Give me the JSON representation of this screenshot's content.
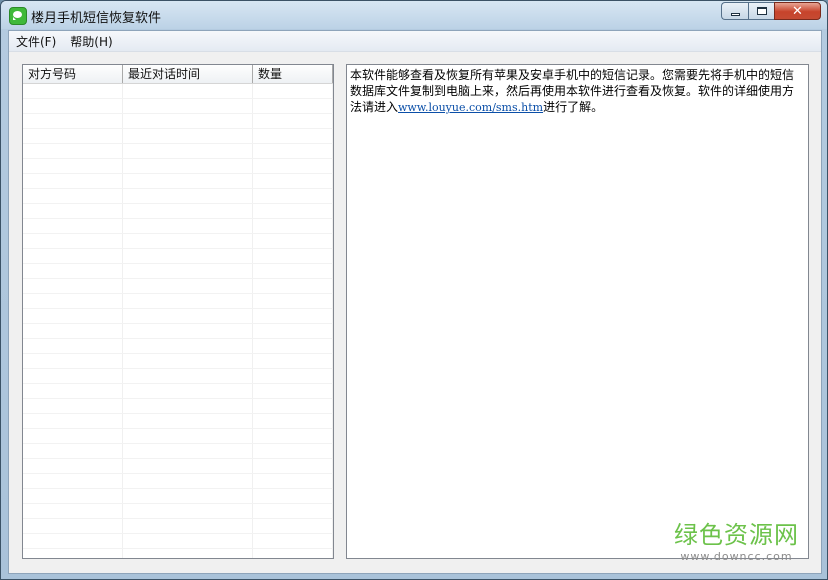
{
  "window": {
    "title": "楼月手机短信恢复软件",
    "icon": "message-bubble-icon",
    "controls": {
      "minimize": "minimize-icon",
      "maximize": "maximize-icon",
      "close": "close-icon"
    }
  },
  "menu": {
    "items": [
      {
        "label": "文件(F)"
      },
      {
        "label": "帮助(H)"
      }
    ]
  },
  "conversation_list": {
    "columns": [
      {
        "label": "对方号码"
      },
      {
        "label": "最近对话时间"
      },
      {
        "label": "数量"
      }
    ],
    "rows": []
  },
  "info_text": {
    "before_link": "本软件能够查看及恢复所有苹果及安卓手机中的短信记录。您需要先将手机中的短信数据库文件复制到电脑上来，然后再使用本软件进行查看及恢复。软件的详细使用方法请进入",
    "link": "www.louyue.com/sms.htm",
    "after_link": "进行了解。"
  },
  "watermark": {
    "text": "绿色资源网",
    "url": "www.downcc.com"
  },
  "colors": {
    "accent": "#6cc24a",
    "link": "#0b4fa8",
    "close_button": "#c7432b"
  }
}
